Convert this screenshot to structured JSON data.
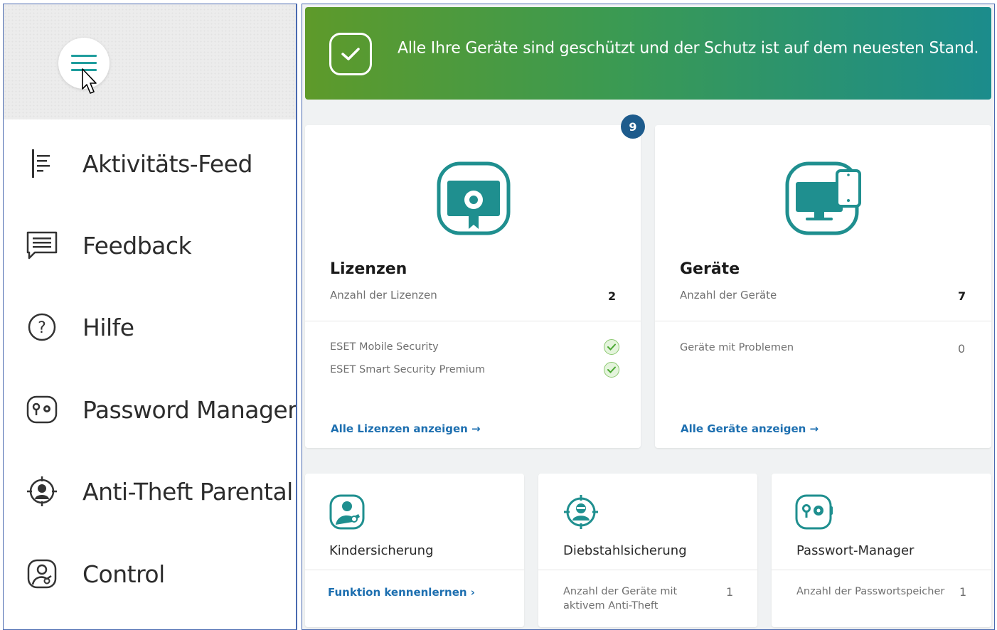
{
  "sidebar": {
    "items": [
      {
        "label": "Aktivitäts-Feed",
        "icon": "activity-feed-icon"
      },
      {
        "label": "Feedback",
        "icon": "feedback-icon"
      },
      {
        "label": "Hilfe",
        "icon": "help-icon"
      },
      {
        "label": "Password Manager",
        "icon": "password-manager-icon"
      },
      {
        "label": "Anti-Theft Parental",
        "icon": "anti-theft-icon"
      },
      {
        "label": "Control",
        "icon": "parental-control-icon"
      }
    ]
  },
  "banner": {
    "text": "Alle Ihre Geräte sind geschützt und der Schutz ist auf dem neuesten Stand."
  },
  "licenses": {
    "badge": "9",
    "title": "Lizenzen",
    "count_label": "Anzahl der Lizenzen",
    "count": "2",
    "items": [
      "ESET Mobile Security",
      "ESET Smart Security Premium"
    ],
    "link": "Alle Lizenzen anzeigen →"
  },
  "devices": {
    "title": "Geräte",
    "count_label": "Anzahl der Geräte",
    "count": "7",
    "problems_label": "Geräte mit Problemen",
    "problems": "0",
    "link": "Alle Geräte anzeigen →"
  },
  "parental": {
    "title": "Kindersicherung",
    "link": "Funktion kennenlernen"
  },
  "antitheft": {
    "title": "Diebstahlsicherung",
    "label_line1": "Anzahl der Geräte mit",
    "label_line2": "aktivem Anti-Theft",
    "value": "1"
  },
  "password": {
    "title": "Passwort-Manager",
    "label": "Anzahl der Passwortspeicher",
    "value": "1"
  },
  "colors": {
    "teal": "#1f8f8f",
    "banner_start": "#5e9a2a",
    "banner_end": "#1b8c8c",
    "link": "#1d6fb0",
    "badge": "#1d5b8c"
  }
}
